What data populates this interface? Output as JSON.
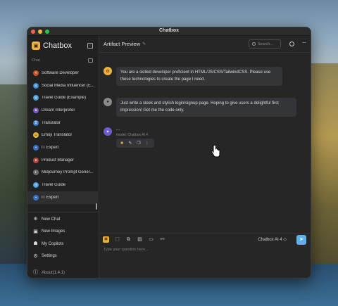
{
  "window": {
    "title": "Chatbox"
  },
  "sidebar": {
    "brand": "Chatbox",
    "chat_label": "Chat",
    "chats": [
      {
        "label": "Software Developer",
        "icon": "code-avatar",
        "color": "#c0562a"
      },
      {
        "label": "Social Media Influencer (E...",
        "icon": "globe-avatar",
        "color": "#3a8bd1"
      },
      {
        "label": "Travel Guide (Example)",
        "icon": "globe-avatar",
        "color": "#4a9bd6"
      },
      {
        "label": "Dream Interpreter",
        "icon": "crystal-avatar",
        "color": "#7b5cc7"
      },
      {
        "label": "Translator",
        "icon": "translate-avatar",
        "color": "#3a7fc4"
      },
      {
        "label": "Emoji Translator",
        "icon": "emoji-avatar",
        "color": "#e8b23a"
      },
      {
        "label": "IT Expert",
        "icon": "robot-avatar",
        "color": "#3b6fc4"
      },
      {
        "label": "Product Manager",
        "icon": "person-avatar",
        "color": "#b5463c"
      },
      {
        "label": "Midjourney Prompt Gener...",
        "icon": "palette-avatar",
        "color": "#6c6c6c"
      },
      {
        "label": "Travel Guide",
        "icon": "globe-avatar",
        "color": "#4a9bd6"
      },
      {
        "label": "IT Expert",
        "icon": "robot-avatar",
        "color": "#3b6fc4"
      }
    ],
    "nav": [
      {
        "label": "New Chat",
        "icon": "plus-circle-icon"
      },
      {
        "label": "New Images",
        "icon": "image-icon"
      },
      {
        "label": "My Copilots",
        "icon": "robot-icon"
      },
      {
        "label": "Settings",
        "icon": "gear-icon"
      },
      {
        "label": "About(1.4.1)",
        "icon": "info-icon"
      }
    ]
  },
  "main": {
    "title": "Artifact Preview",
    "search_placeholder": "Search...",
    "messages": [
      {
        "role": "system",
        "text": "You are a skilled developer proficient in HTML/JS/CSS/TailwindCSS. Please use these technologies to create the page I need."
      },
      {
        "role": "user",
        "text": "Just write a sleek and stylish login/signup page. Hoping to give users a delightful first impression! Get me the code only."
      },
      {
        "role": "assistant",
        "text": "...",
        "model": "model: Chatbox AI 4"
      }
    ]
  },
  "composer": {
    "model_label": "Chatbox AI 4 ◇",
    "placeholder": "Type your question here..."
  },
  "colors": {
    "accent": "#f0b03c",
    "send": "#5fb0e8"
  }
}
